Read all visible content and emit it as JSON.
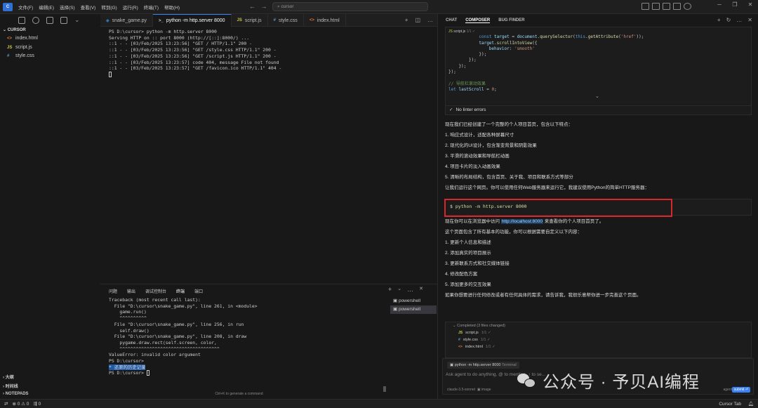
{
  "titlebar": {
    "menu": [
      "文件(F)",
      "编辑(E)",
      "选择(S)",
      "查看(V)",
      "转到(G)",
      "运行(R)",
      "终端(T)",
      "帮助(H)"
    ],
    "search_placeholder": "cursor"
  },
  "explorer": {
    "header": "CURSOR",
    "files": [
      {
        "name": "index.html",
        "icon": "<>",
        "color": "#e37933"
      },
      {
        "name": "script.js",
        "icon": "JS",
        "color": "#cbcb41"
      },
      {
        "name": "style.css",
        "icon": "#",
        "color": "#519aba"
      }
    ],
    "outline": [
      "大纲",
      "时间线",
      "NOTEPADS"
    ]
  },
  "tabs": [
    {
      "label": "snake_game.py",
      "icon": "◆",
      "color": "#3572a5",
      "active": false
    },
    {
      "label": "python -m http.server 8000",
      "icon": ">_",
      "color": "#ccc",
      "active": true
    },
    {
      "label": "script.js",
      "icon": "JS",
      "color": "#cbcb41",
      "active": false
    },
    {
      "label": "style.css",
      "icon": "#",
      "color": "#519aba",
      "active": false
    },
    {
      "label": "index.html",
      "icon": "<>",
      "color": "#e37933",
      "active": false
    }
  ],
  "terminal_top": [
    "PS D:\\cursor> python -m http.server 8000",
    "Serving HTTP on :: port 8000 (http://[::]:8000/) ...",
    "::1 - - [03/Feb/2025 13:23:56] \"GET / HTTP/1.1\" 200 -",
    "::1 - - [03/Feb/2025 13:23:56] \"GET /style.css HTTP/1.1\" 200 -",
    "::1 - - [03/Feb/2025 13:23:56] \"GET /script.js HTTP/1.1\" 200 -",
    "::1 - - [03/Feb/2025 13:23:57] code 404, message File not found",
    "::1 - - [03/Feb/2025 13:23:57] \"GET /favicon.ico HTTP/1.1\" 404 -"
  ],
  "panel": {
    "tabs": [
      "问题",
      "输出",
      "调试控制台",
      "终端",
      "端口"
    ],
    "terminal_lines": [
      "Traceback (most recent call last):",
      "  File \"D:\\cursor\\snake_game.py\", line 261, in <module>",
      "    game.run()",
      "    ^^^^^^^^^^",
      "  File \"D:\\cursor\\snake_game.py\", line 256, in run",
      "    self.draw()",
      "  File \"D:\\cursor\\snake_game.py\", line 208, in draw",
      "    pygame.draw.rect(self.screen, color,",
      "    ^^^^^^^^^^^^^^^^^^^^^^^^^^^^^^^^^^^^^",
      "ValueError: invalid color argument",
      "PS D:\\cursor>"
    ],
    "history_label": "* 还原的历史记录",
    "prompt_last": "PS D:\\cursor> ",
    "terminals": [
      "powershell",
      "powershell"
    ],
    "hint": "Ctrl+K to generate a command"
  },
  "chat": {
    "tabs": [
      "CHAT",
      "COMPOSER",
      "BUG FINDER"
    ],
    "code_file": "script.js",
    "code_file_note": "1/1 ✓",
    "linter": "No linter errors",
    "intro": "现在我们已经创建了一个完整的个人项目首页，包含以下特点：",
    "features": [
      "1. 响应式设计，适配各种屏幕尺寸",
      "2. 现代化的UI设计，包含渐变背景和阴影效果",
      "3. 平滑的滚动效果和导航栏动画",
      "4. 项目卡片的淡入动画效果",
      "5. 清晰的布局结构，包含首页、关于我、项目和联系方式等部分"
    ],
    "run_hint": "让我们运行这个网页。你可以使用任何Web服务器来运行它，我建议使用Python的简单HTTP服务器：",
    "command_prompt": "$",
    "command": "python -m http.server 8000",
    "visit_before": "现在你可以在浏览器中访问 ",
    "visit_link": "http://localhost:8000",
    "visit_after": " 来查看你的个人项目首页了。",
    "custom_intro": "这个页面包含了所有基本的功能，你可以根据需要自定义以下内容：",
    "customs": [
      "1. 更新个人信息和描述",
      "2. 添加真实的项目展示",
      "3. 更新联系方式和社交媒体链接",
      "4. 修改配色方案",
      "5. 添加更多的交互效果"
    ],
    "outro": "如果你想要进行任何修改或者有任何具体的需求，请告诉我，我很乐意帮你进一步完善这个页面。",
    "completed": {
      "header": "Completed (3 files changed)",
      "files": [
        {
          "name": "script.js",
          "icon": "JS",
          "color": "#cbcb41",
          "note": "1/1 ✓"
        },
        {
          "name": "style.css",
          "icon": "#",
          "color": "#519aba",
          "note": "1/1 ✓"
        },
        {
          "name": "index.html",
          "icon": "<>",
          "color": "#e37933",
          "note": "1/1 ✓"
        }
      ]
    },
    "input": {
      "context_chip": "python -m http.server 8000",
      "context_tag": "Terminal",
      "placeholder": "Ask agent to do anything, @ to mention, ↑ to se...",
      "model": "claude-3.5-sonnet",
      "image_label": "image",
      "agent_label": "agent",
      "submit_label": "submit ⏎"
    }
  },
  "statusbar": {
    "left": "⊗ 0 ⚠ 0",
    "ports": "0",
    "right": "Cursor Tab"
  },
  "watermark": "公众号 · 予贝AI编程"
}
